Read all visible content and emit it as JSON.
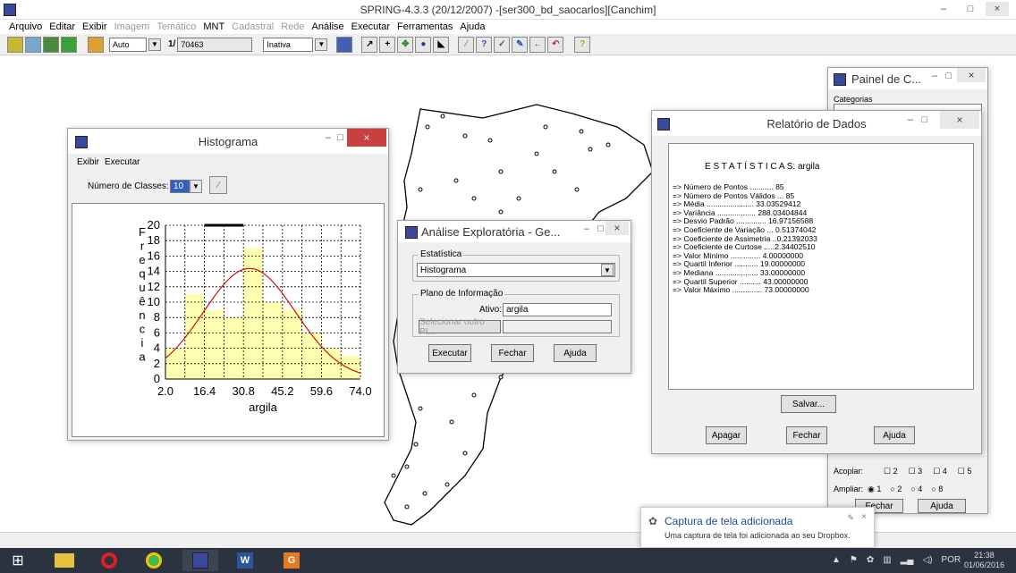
{
  "window": {
    "title": "SPRING-4.3.3 (20/12/2007) -[ser300_bd_saocarlos][Canchim]",
    "minimize": "–",
    "maximize": "□",
    "close": "×"
  },
  "menu": [
    {
      "label": "Arquivo",
      "enabled": true
    },
    {
      "label": "Editar",
      "enabled": true
    },
    {
      "label": "Exibir",
      "enabled": true
    },
    {
      "label": "Imagem",
      "enabled": false
    },
    {
      "label": "Temático",
      "enabled": false
    },
    {
      "label": "MNT",
      "enabled": true
    },
    {
      "label": "Cadastral",
      "enabled": false
    },
    {
      "label": "Rede",
      "enabled": false
    },
    {
      "label": "Análise",
      "enabled": true
    },
    {
      "label": "Executar",
      "enabled": true
    },
    {
      "label": "Ferramentas",
      "enabled": true
    },
    {
      "label": "Ajuda",
      "enabled": true
    }
  ],
  "toolbar": {
    "zoom_mode": "Auto",
    "scale_prefix": "1/",
    "scale_value": "70463",
    "mode": "Inativa"
  },
  "histogram": {
    "title": "Histograma",
    "menu": [
      "Exibir",
      "Executar"
    ],
    "classes_label": "Número de Classes:",
    "classes_value": "10",
    "ylabel": [
      "F",
      "r",
      "e",
      "q",
      "u",
      "ê",
      "n",
      "c",
      "i",
      "a"
    ],
    "chart_data": {
      "type": "bar",
      "title": "",
      "xlabel": "argila",
      "ylabel": "Frequência",
      "x_ticks": [
        "2.0",
        "16.4",
        "30.8",
        "45.2",
        "59.6",
        "74.0"
      ],
      "y_ticks": [
        "0",
        "2",
        "4",
        "6",
        "8",
        "10",
        "12",
        "14",
        "16",
        "18",
        "20"
      ],
      "ylim": [
        0,
        20
      ],
      "xlim": [
        2.0,
        74.0
      ],
      "bin_edges": [
        2.0,
        9.2,
        16.4,
        23.6,
        30.8,
        38.0,
        45.2,
        52.4,
        59.6,
        66.8,
        74.0
      ],
      "values": [
        4,
        11,
        9,
        8,
        17,
        10,
        9,
        6,
        4,
        3
      ],
      "normal_curve": {
        "mean": 33.03529412,
        "std": 16.97156588,
        "color": "#d01010"
      },
      "bar_color": "#ffffb0",
      "grid": true
    }
  },
  "analise": {
    "title": "Análise Exploratória - Ge...",
    "estatistica_label": "Estatística",
    "estatistica_value": "Histograma",
    "plano_label": "Plano de Informação",
    "ativo_label": "Ativo:",
    "ativo_value": "argila",
    "selecionar": "Selecionar outro PI...",
    "executar": "Executar",
    "fechar": "Fechar",
    "ajuda": "Ajuda"
  },
  "relatorio": {
    "title": "Relatório de Dados",
    "heading": "E S T A T Í S T I C A S: argila",
    "lines": [
      "=> Número de Pontos ........... 85",
      "=> Número de Pontos Válidos ... 85",
      "=> Média ...................... 33.03529412",
      "=> Variância .................. 288.03404844",
      "=> Desvio Padrão .............. 16.97156588",
      "=> Coeficiente de Variação ... 0.51374042",
      "=> Coeficiente de Assimetria ..0.21392033",
      "=> Coeficiente de Curtose .....2.34402510",
      "=> Valor Mínimo .............. 4.00000000",
      "=> Quartil Inferior ........... 19.00000000",
      "=> Mediana .................... 33.00000000",
      "=> Quartil Superior .......... 43.00000000",
      "=> Valor Máximo .............. 73.00000000"
    ],
    "salvar": "Salvar...",
    "apagar": "Apagar",
    "fechar": "Fechar",
    "ajuda": "Ajuda"
  },
  "painel": {
    "title": "Painel de C...",
    "categorias": "Categorias",
    "acoplar": "Acoplar:",
    "acoplar_opts": [
      "2",
      "3",
      "4",
      "5"
    ],
    "ampliar": "Ampliar:",
    "ampliar_opts": [
      "1",
      "2",
      "4",
      "8"
    ],
    "fechar": "Fechar",
    "ajuda": "Ajuda"
  },
  "notification": {
    "title": "Captura de tela adicionada",
    "text": "Uma captura de tela foi adicionada ao seu Dropbox."
  },
  "tray": {
    "lang": "POR",
    "time": "21:38",
    "date": "01/06/2016"
  }
}
